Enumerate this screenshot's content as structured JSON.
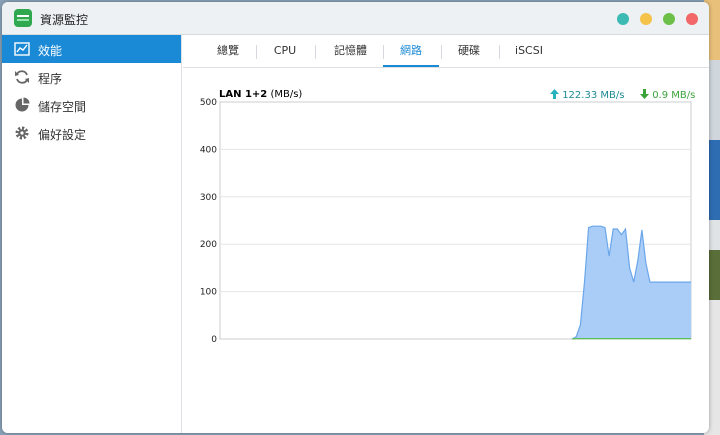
{
  "window": {
    "title": "資源監控"
  },
  "sidebar": {
    "items": [
      {
        "label": "效能",
        "icon": "chart-icon",
        "active": true
      },
      {
        "label": "程序",
        "icon": "refresh-icon",
        "active": false
      },
      {
        "label": "儲存空間",
        "icon": "pie-icon",
        "active": false
      },
      {
        "label": "偏好設定",
        "icon": "gear-icon",
        "active": false
      }
    ]
  },
  "tabs": [
    {
      "label": "總覽"
    },
    {
      "label": "CPU"
    },
    {
      "label": "記憶體"
    },
    {
      "label": "網路",
      "active": true
    },
    {
      "label": "硬碟"
    },
    {
      "label": "iSCSI"
    }
  ],
  "chart": {
    "title_bold": "LAN 1+2",
    "title_unit": "(MB/s)",
    "upload_label": "122.33 MB/s",
    "download_label": "0.9 MB/s",
    "upload_color": "#27b3bd",
    "download_color": "#3aa33a"
  },
  "chart_data": {
    "type": "area",
    "ylim": [
      0,
      500
    ],
    "yticks": [
      "500",
      "400",
      "300",
      "200",
      "100",
      "0"
    ],
    "series": [
      {
        "values": [
          0,
          0,
          0,
          0,
          0,
          0,
          0,
          0,
          0,
          0,
          0,
          0,
          0,
          0,
          0,
          0,
          0,
          0,
          0,
          0,
          0,
          0,
          0,
          0,
          0,
          0,
          0,
          0,
          0,
          0,
          0,
          0,
          0,
          0,
          0,
          0,
          0,
          0,
          0,
          0,
          0,
          0,
          0,
          0,
          0,
          0,
          0,
          0,
          0,
          0,
          0,
          0,
          0,
          0,
          0,
          0,
          0,
          0,
          0,
          0,
          0,
          0,
          0,
          0,
          0,
          0,
          0,
          0,
          0,
          0,
          0,
          0,
          0,
          0,
          0,
          0,
          0,
          0,
          0,
          0,
          0,
          0,
          0,
          0,
          0,
          0,
          0,
          5,
          30,
          120,
          235,
          238,
          238,
          238,
          235,
          175,
          232,
          232,
          220,
          232,
          150,
          120,
          165,
          230,
          160,
          120,
          120,
          120,
          120,
          120,
          120,
          120,
          120,
          120,
          120,
          120
        ]
      },
      {
        "values": [
          0,
          0,
          0,
          0,
          0,
          0,
          0,
          0,
          0,
          0,
          0,
          0,
          0,
          0,
          0,
          0,
          0,
          0,
          0,
          0,
          0,
          0,
          0,
          0,
          0,
          0,
          0,
          0,
          0,
          0,
          0,
          0,
          0,
          0,
          0,
          0,
          0,
          0,
          0,
          0,
          0,
          0,
          0,
          0,
          0,
          0,
          0,
          0,
          0,
          0,
          0,
          0,
          0,
          0,
          0,
          0,
          0,
          0,
          0,
          0,
          0,
          0,
          0,
          0,
          0,
          0,
          0,
          0,
          0,
          0,
          0,
          0,
          0,
          0,
          0,
          0,
          0,
          0,
          0,
          0,
          0,
          0,
          0,
          0,
          0,
          0,
          0,
          0.9,
          0.9,
          0.9,
          0.9,
          0.9,
          0.9,
          0.9,
          0.9,
          0.9,
          0.9,
          0.9,
          0.9,
          0.9,
          0.9,
          0.9,
          0.9,
          0.9,
          0.9,
          0.9,
          0.9,
          0.9,
          0.9,
          0.9,
          0.9,
          0.9,
          0.9,
          0.9,
          0.9,
          0.9
        ]
      }
    ]
  }
}
